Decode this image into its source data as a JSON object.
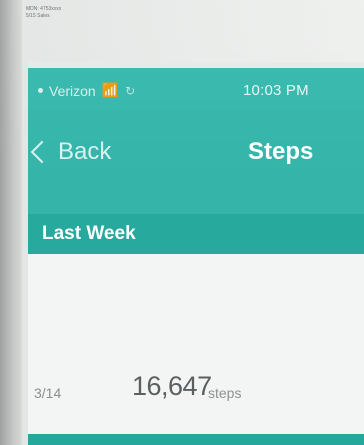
{
  "sticker": {
    "line1": "MDN: 4753xxxx",
    "line2": "5/15 Sales"
  },
  "status_bar": {
    "carrier": "Verizon",
    "time": "10:03 PM"
  },
  "nav": {
    "back_label": "Back",
    "title": "Steps"
  },
  "section": {
    "label": "Last Week"
  },
  "entries": [
    {
      "date": "3/14",
      "count": "16,647",
      "unit": "steps"
    }
  ],
  "colors": {
    "teal_primary": "#35b5aa",
    "teal_dark": "#27a99e",
    "text_muted": "#8a8e8d"
  }
}
